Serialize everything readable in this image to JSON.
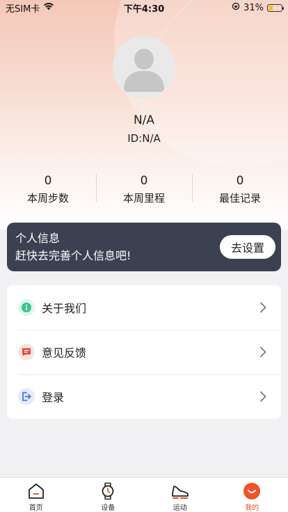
{
  "status_bar": {
    "carrier": "无SIM卡",
    "time": "下午4:30",
    "battery": "31%",
    "battery_level": 0.31
  },
  "profile": {
    "name": "N/A",
    "id": "ID:N/A"
  },
  "stats": [
    {
      "value": "0",
      "label": "本周步数"
    },
    {
      "value": "0",
      "label": "本周里程"
    },
    {
      "value": "0",
      "label": "最佳记录"
    }
  ],
  "info_banner": {
    "title": "个人信息",
    "description": "赶快去完善个人信息吧!",
    "button_label": "去设置"
  },
  "menu": [
    {
      "label": "关于我们",
      "icon": "info-icon",
      "color": "#3cc48c",
      "bg": "#e0f6ec"
    },
    {
      "label": "意见反馈",
      "icon": "feedback-icon",
      "color": "#e8473d",
      "bg": "#fbe5e3"
    },
    {
      "label": "登录",
      "icon": "login-icon",
      "color": "#4a73e8",
      "bg": "#e4ebfb"
    }
  ],
  "tabs": [
    {
      "label": "首页",
      "icon": "home-icon"
    },
    {
      "label": "设备",
      "icon": "watch-icon"
    },
    {
      "label": "运动",
      "icon": "shoe-icon"
    },
    {
      "label": "我的",
      "icon": "profile-smile-icon",
      "active": true
    }
  ],
  "colors": {
    "accent": "#f0522a",
    "banner_bg": "#3c4152"
  }
}
